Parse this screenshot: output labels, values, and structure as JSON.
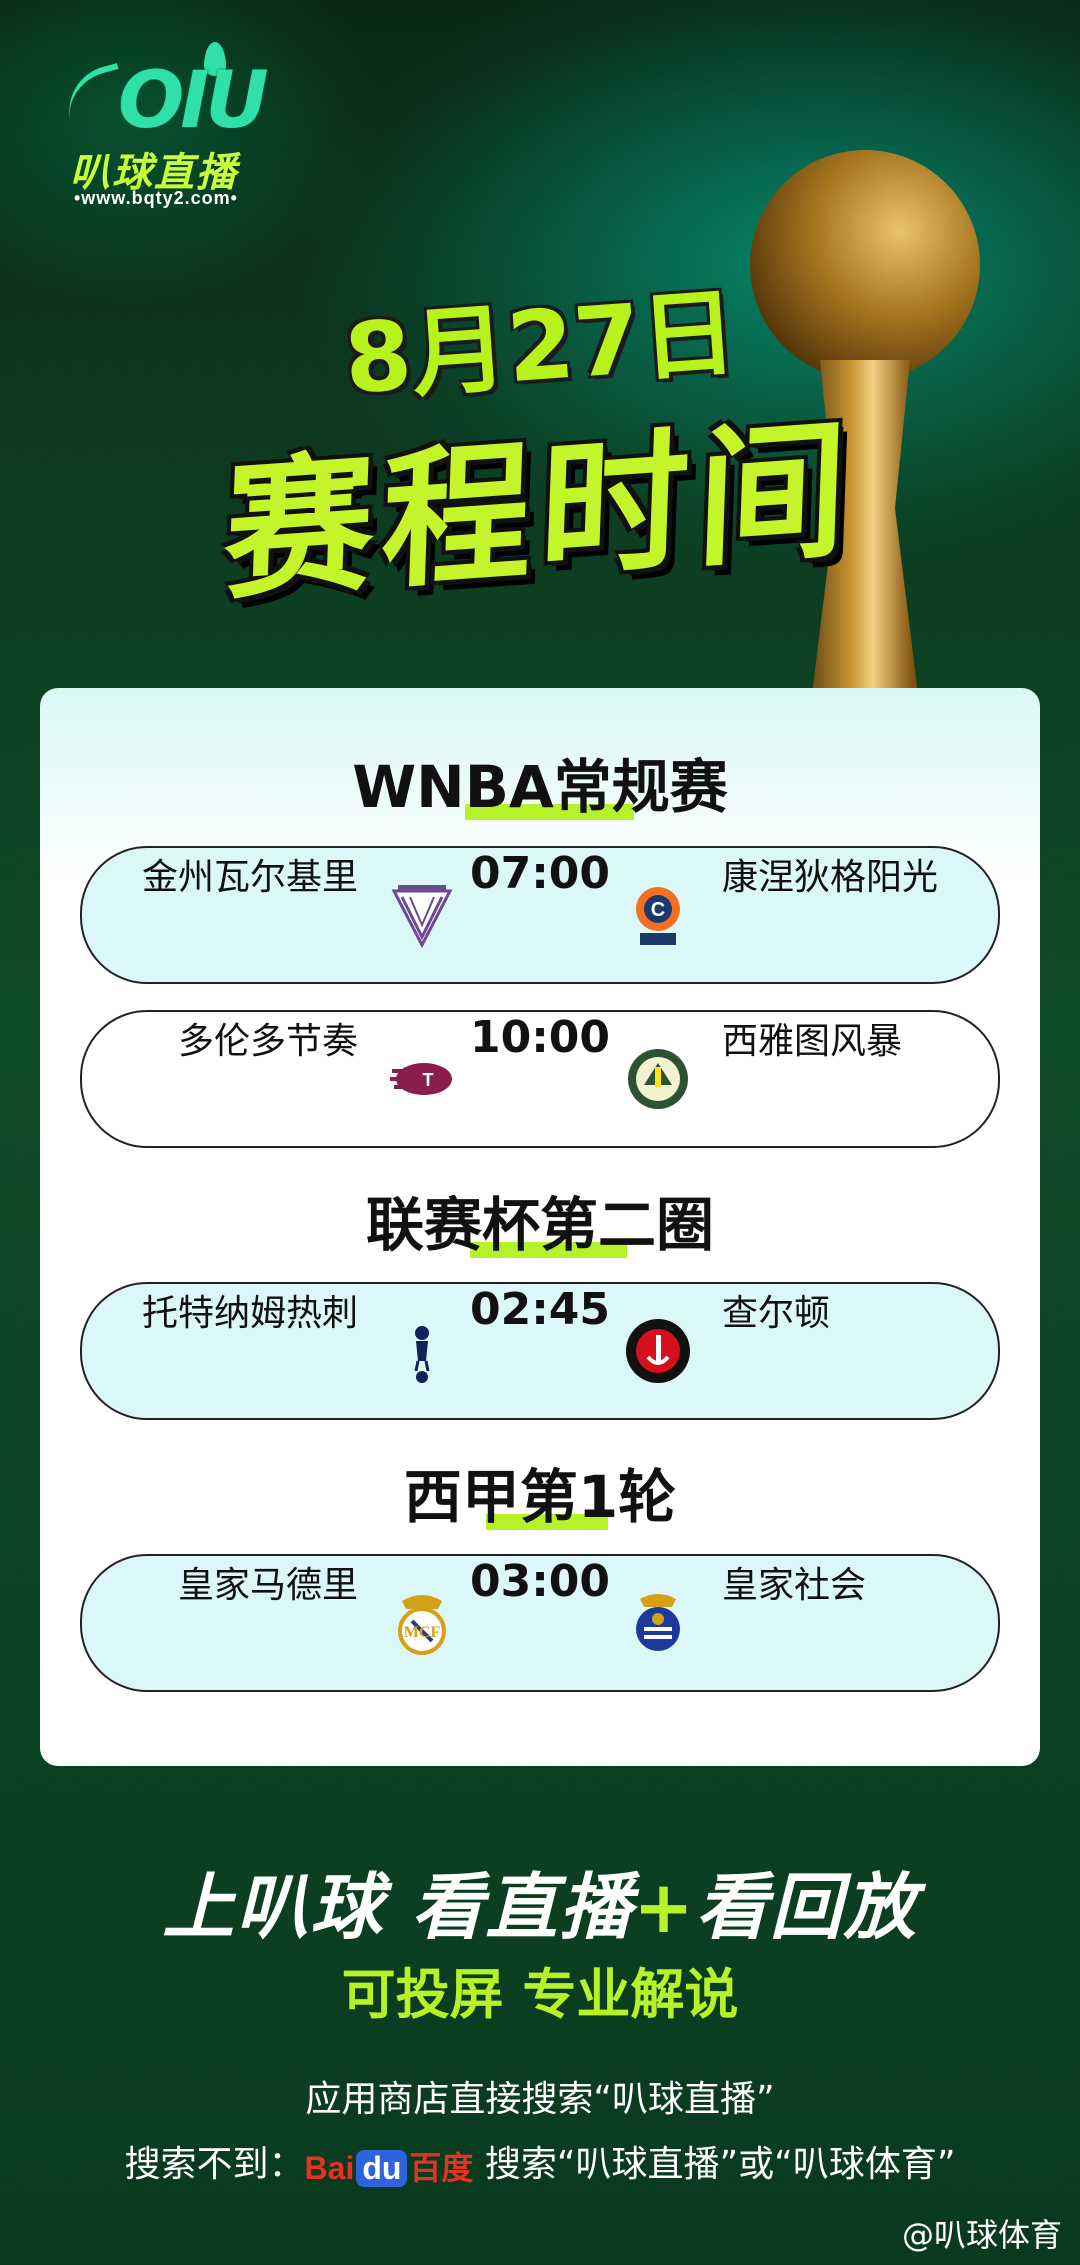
{
  "logo": {
    "mark": "OIU",
    "name": "叭球直播",
    "url": "•www.bqty2.com•"
  },
  "header": {
    "date": "8月27日",
    "title": "赛程时间"
  },
  "sections": [
    {
      "title": "WNBA常规赛",
      "matches": [
        {
          "home": "金州瓦尔基里",
          "time": "07:00",
          "away": "康涅狄格阳光"
        },
        {
          "home": "多伦多节奏",
          "time": "10:00",
          "away": "西雅图风暴"
        }
      ]
    },
    {
      "title": "联赛杯第二圈",
      "matches": [
        {
          "home": "托特纳姆热刺",
          "time": "02:45",
          "away": "查尔顿"
        }
      ]
    },
    {
      "title": "西甲第1轮",
      "matches": [
        {
          "home": "皇家马德里",
          "time": "03:00",
          "away": "皇家社会"
        }
      ]
    }
  ],
  "promo": {
    "slogan_a": "上叭球  看直播",
    "slogan_plus": "+",
    "slogan_b": "看回放",
    "sub": "可投屏 专业解说",
    "info1": "应用商店直接搜索“叭球直播”",
    "info2_prefix": "搜索不到：",
    "baidu_a": "Bai",
    "baidu_b": "du",
    "baidu_c": "百度",
    "info2_suffix": " 搜索“叭球直播”或“叭球体育”"
  },
  "watermark": "@叭球体育",
  "colors": {
    "accent": "#b5f22a",
    "teal_row": "#dcf7f7"
  }
}
